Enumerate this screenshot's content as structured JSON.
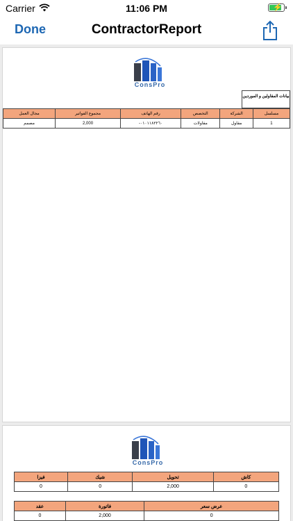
{
  "status_bar": {
    "carrier": "Carrier",
    "time": "11:06 PM",
    "battery_level": 0.85,
    "battery_color": "#34c759"
  },
  "nav": {
    "done_label": "Done",
    "title": "ContractorReport",
    "accent": "#1d67b3"
  },
  "logo": {
    "text": "ConsPro"
  },
  "report": {
    "title": "بيانات المقاولين و الموردين",
    "header_fill": "#f3a57d",
    "columns": [
      "مسلسل",
      "الشركة",
      "التخصص",
      "رقم الهاتف",
      "مجموع الفواتير",
      "مجال العمل"
    ],
    "rows": [
      [
        "1",
        "مقاول",
        "مقاولات",
        "٠١٠١١٨٢٢٦٠-",
        "2,000",
        "مصمم"
      ]
    ]
  },
  "payments": {
    "columns": [
      "كاش",
      "تحويل",
      "شيك",
      "فيزا"
    ],
    "values": [
      "0",
      "2,000",
      "0",
      "0"
    ]
  },
  "documents": {
    "columns": [
      "عرض سعر",
      "فاتورة",
      "عقد"
    ],
    "values": [
      "0",
      "2,000",
      "0"
    ]
  }
}
